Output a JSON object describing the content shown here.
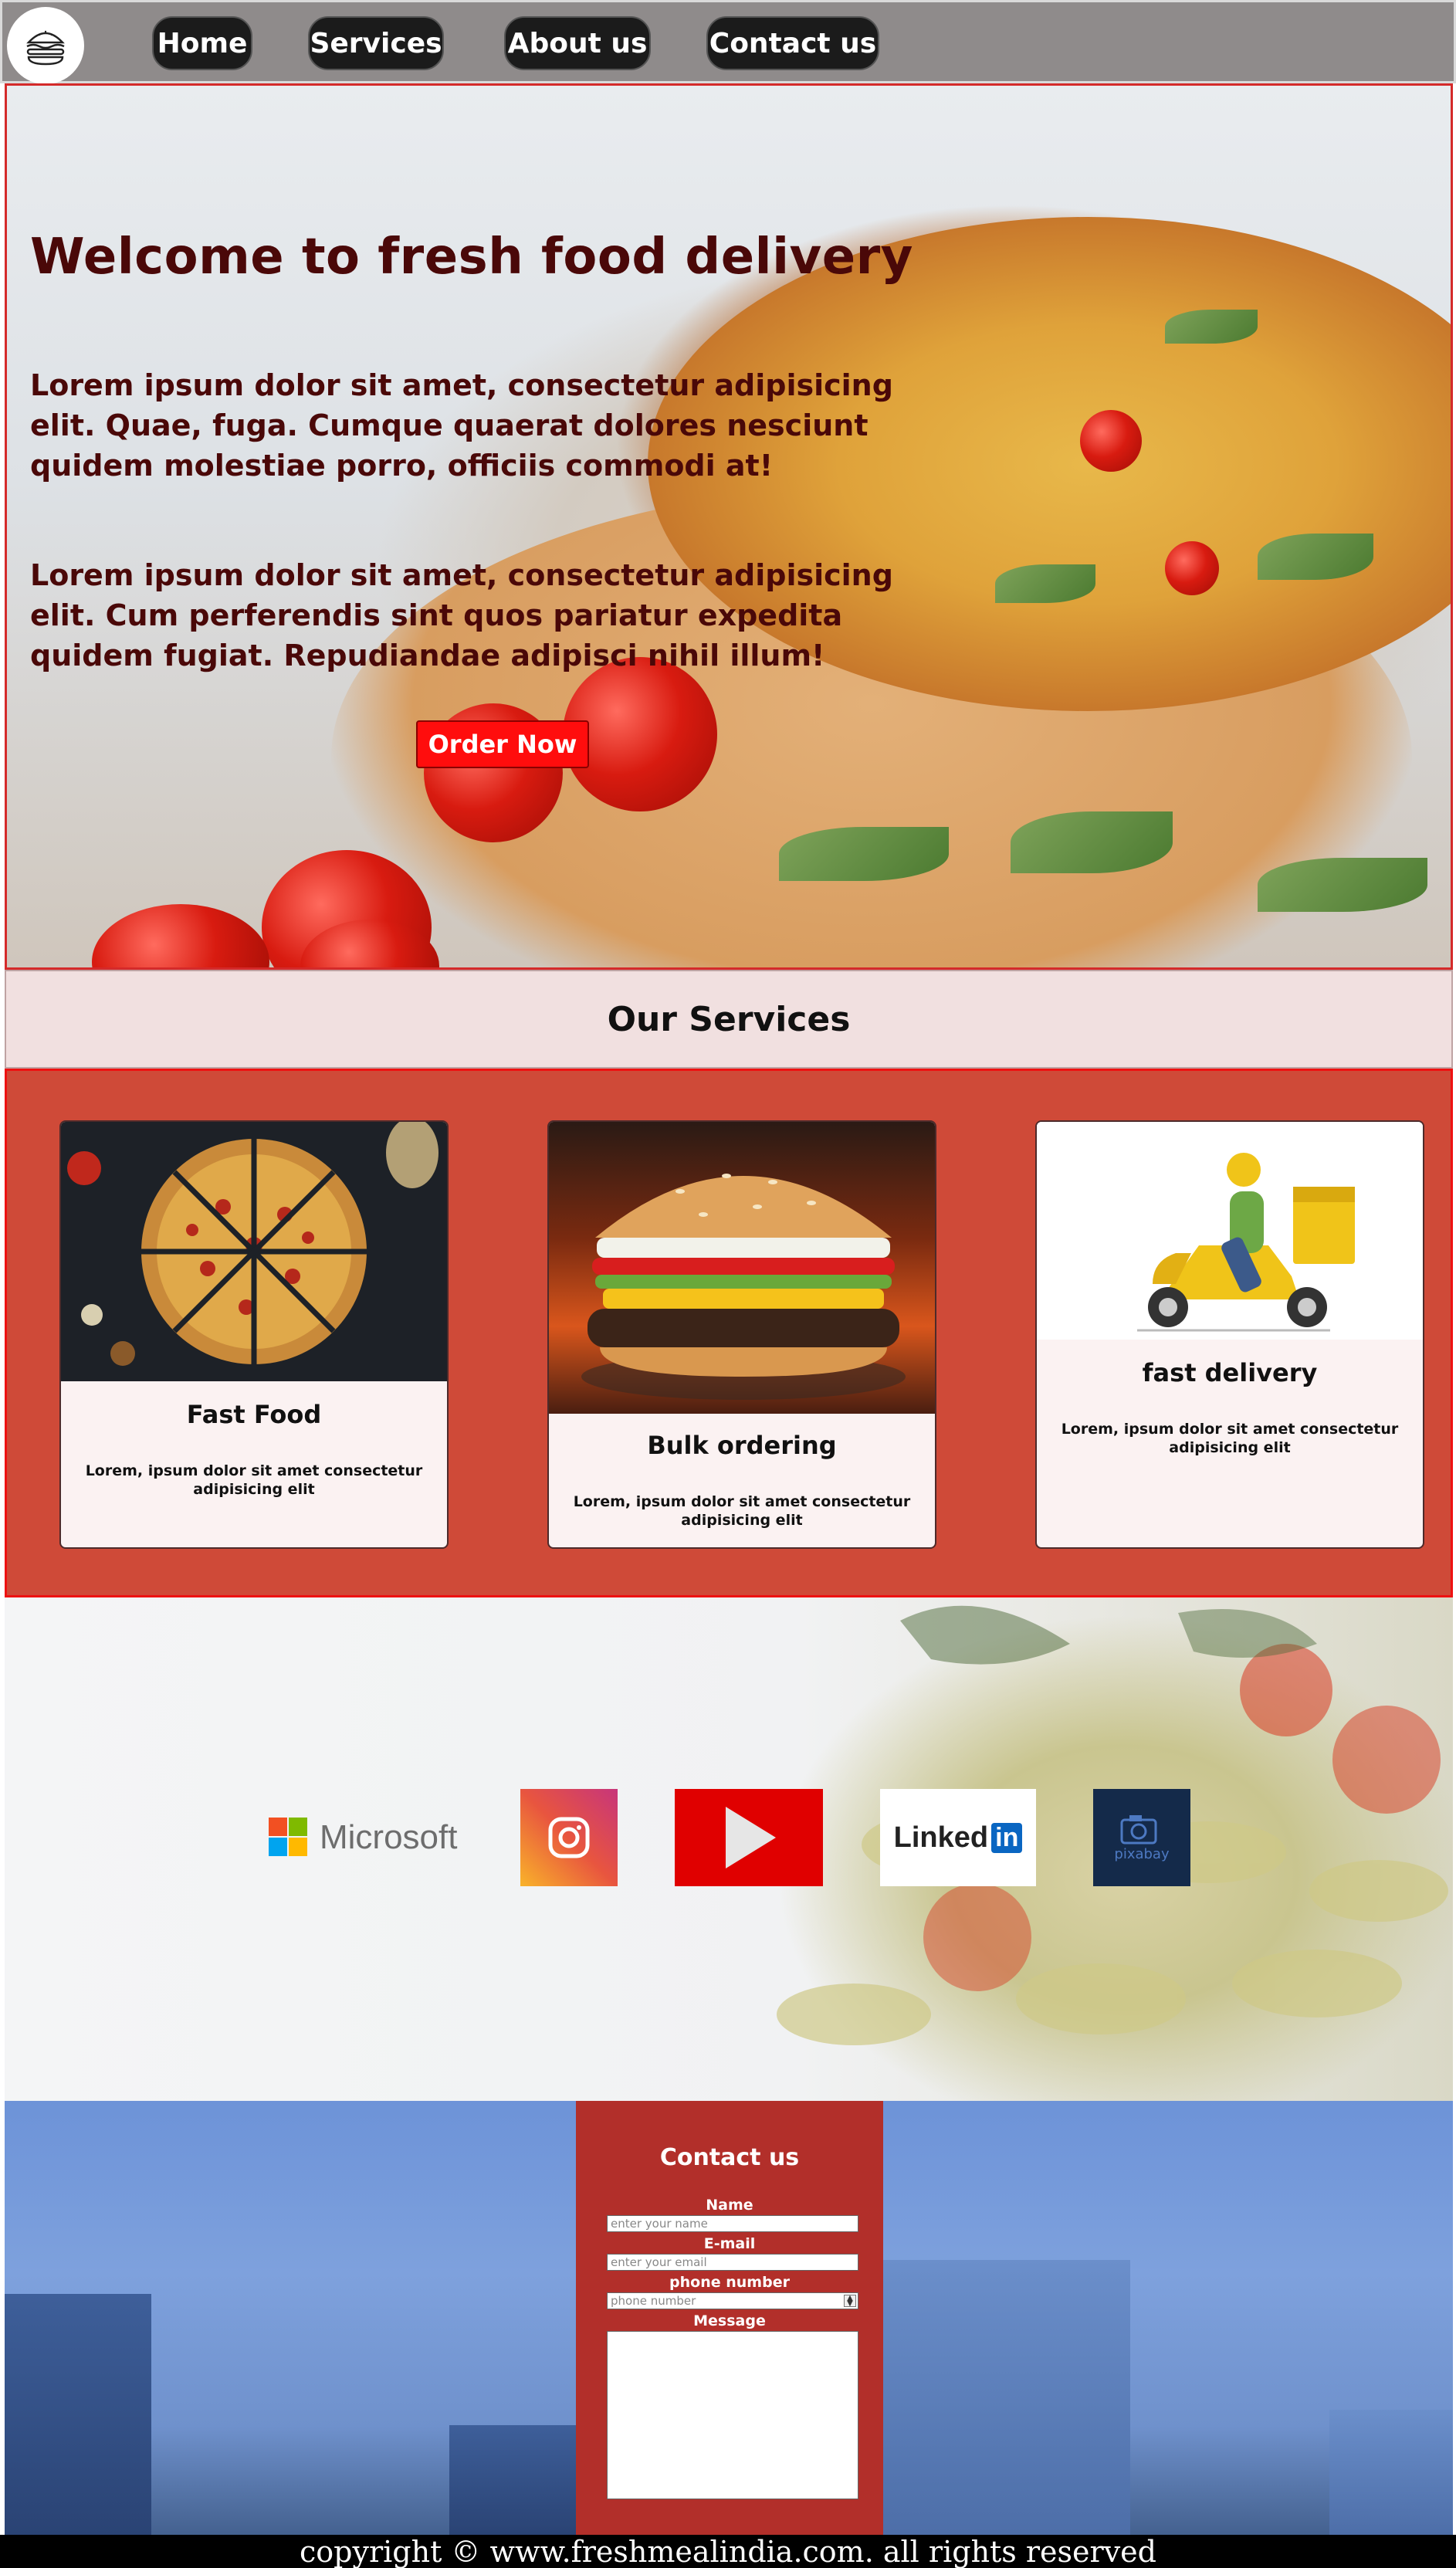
{
  "nav": {
    "logo_icon": "burger-logo-icon",
    "items": [
      {
        "label": "Home"
      },
      {
        "label": "Services"
      },
      {
        "label": "About us"
      },
      {
        "label": "Contact us"
      }
    ]
  },
  "hero": {
    "title": "Welcome to fresh food delivery",
    "paragraph_1": "Lorem ipsum dolor sit amet, consectetur adipisicing elit. Quae, fuga. Cumque quaerat dolores nesciunt quidem molestiae porro, officiis commodi at!",
    "paragraph_2": "Lorem ipsum dolor sit amet, consectetur adipisicing elit. Cum perferendis sint quos pariatur expedita quidem fugiat. Repudiandae adipisci nihil illum!",
    "order_button": "Order Now",
    "button_color": "#ff0d0d",
    "text_color": "#4a0808"
  },
  "services": {
    "heading": "Our Services",
    "background_color": "#cf4a38",
    "cards": [
      {
        "title": "Fast Food",
        "text": "Lorem, ipsum dolor sit amet consectetur adipisicing elit",
        "image": "pizza-photo"
      },
      {
        "title": "Bulk ordering",
        "text": "Lorem, ipsum dolor sit amet consectetur adipisicing elit",
        "image": "burger-photo"
      },
      {
        "title": "fast delivery",
        "text": "Lorem, ipsum dolor sit amet consectetur adipisicing elit",
        "image": "delivery-scooter-illustration"
      }
    ]
  },
  "social": {
    "logos": [
      {
        "name": "Microsoft",
        "icon": "microsoft-logo-icon"
      },
      {
        "name": "",
        "icon": "instagram-logo-icon"
      },
      {
        "name": "",
        "icon": "youtube-logo-icon"
      },
      {
        "name": "Linked",
        "badge": "in",
        "icon": "linkedin-logo-icon"
      },
      {
        "name": "pixabay",
        "icon": "pixabay-logo-icon"
      }
    ]
  },
  "contact": {
    "title": "Contact us",
    "fields": {
      "name_label": "Name",
      "name_placeholder": "enter your name",
      "email_label": "E-mail",
      "email_placeholder": "enter your email",
      "phone_label": "phone number",
      "phone_placeholder": "phone number",
      "message_label": "Message"
    },
    "panel_color": "#b22f2a"
  },
  "footer": {
    "text": "copyright © www.freshmealindia.com. all rights reserved"
  }
}
